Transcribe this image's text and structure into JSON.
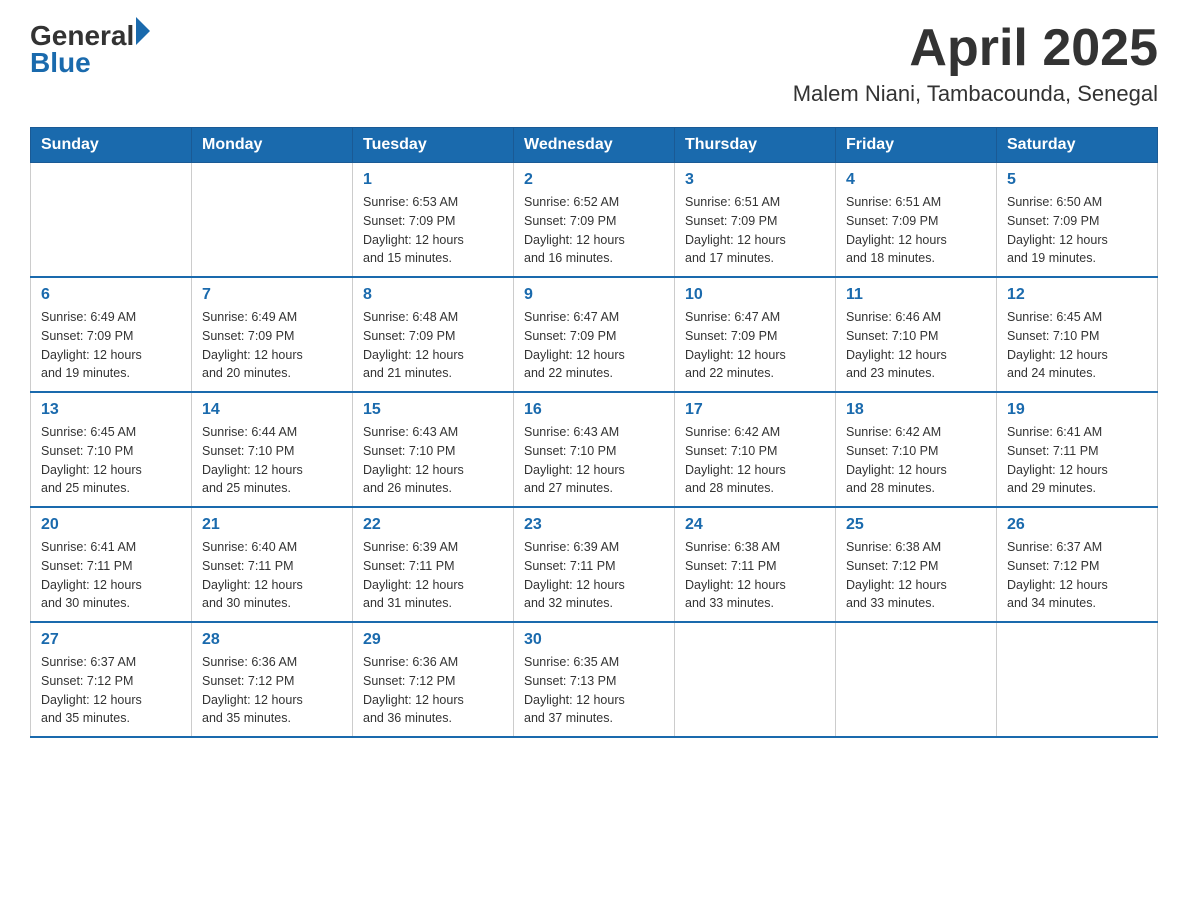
{
  "header": {
    "logo_general": "General",
    "logo_blue": "Blue",
    "title": "April 2025",
    "subtitle": "Malem Niani, Tambacounda, Senegal"
  },
  "calendar": {
    "days_of_week": [
      "Sunday",
      "Monday",
      "Tuesday",
      "Wednesday",
      "Thursday",
      "Friday",
      "Saturday"
    ],
    "weeks": [
      [
        {
          "day": "",
          "info": ""
        },
        {
          "day": "",
          "info": ""
        },
        {
          "day": "1",
          "info": "Sunrise: 6:53 AM\nSunset: 7:09 PM\nDaylight: 12 hours\nand 15 minutes."
        },
        {
          "day": "2",
          "info": "Sunrise: 6:52 AM\nSunset: 7:09 PM\nDaylight: 12 hours\nand 16 minutes."
        },
        {
          "day": "3",
          "info": "Sunrise: 6:51 AM\nSunset: 7:09 PM\nDaylight: 12 hours\nand 17 minutes."
        },
        {
          "day": "4",
          "info": "Sunrise: 6:51 AM\nSunset: 7:09 PM\nDaylight: 12 hours\nand 18 minutes."
        },
        {
          "day": "5",
          "info": "Sunrise: 6:50 AM\nSunset: 7:09 PM\nDaylight: 12 hours\nand 19 minutes."
        }
      ],
      [
        {
          "day": "6",
          "info": "Sunrise: 6:49 AM\nSunset: 7:09 PM\nDaylight: 12 hours\nand 19 minutes."
        },
        {
          "day": "7",
          "info": "Sunrise: 6:49 AM\nSunset: 7:09 PM\nDaylight: 12 hours\nand 20 minutes."
        },
        {
          "day": "8",
          "info": "Sunrise: 6:48 AM\nSunset: 7:09 PM\nDaylight: 12 hours\nand 21 minutes."
        },
        {
          "day": "9",
          "info": "Sunrise: 6:47 AM\nSunset: 7:09 PM\nDaylight: 12 hours\nand 22 minutes."
        },
        {
          "day": "10",
          "info": "Sunrise: 6:47 AM\nSunset: 7:09 PM\nDaylight: 12 hours\nand 22 minutes."
        },
        {
          "day": "11",
          "info": "Sunrise: 6:46 AM\nSunset: 7:10 PM\nDaylight: 12 hours\nand 23 minutes."
        },
        {
          "day": "12",
          "info": "Sunrise: 6:45 AM\nSunset: 7:10 PM\nDaylight: 12 hours\nand 24 minutes."
        }
      ],
      [
        {
          "day": "13",
          "info": "Sunrise: 6:45 AM\nSunset: 7:10 PM\nDaylight: 12 hours\nand 25 minutes."
        },
        {
          "day": "14",
          "info": "Sunrise: 6:44 AM\nSunset: 7:10 PM\nDaylight: 12 hours\nand 25 minutes."
        },
        {
          "day": "15",
          "info": "Sunrise: 6:43 AM\nSunset: 7:10 PM\nDaylight: 12 hours\nand 26 minutes."
        },
        {
          "day": "16",
          "info": "Sunrise: 6:43 AM\nSunset: 7:10 PM\nDaylight: 12 hours\nand 27 minutes."
        },
        {
          "day": "17",
          "info": "Sunrise: 6:42 AM\nSunset: 7:10 PM\nDaylight: 12 hours\nand 28 minutes."
        },
        {
          "day": "18",
          "info": "Sunrise: 6:42 AM\nSunset: 7:10 PM\nDaylight: 12 hours\nand 28 minutes."
        },
        {
          "day": "19",
          "info": "Sunrise: 6:41 AM\nSunset: 7:11 PM\nDaylight: 12 hours\nand 29 minutes."
        }
      ],
      [
        {
          "day": "20",
          "info": "Sunrise: 6:41 AM\nSunset: 7:11 PM\nDaylight: 12 hours\nand 30 minutes."
        },
        {
          "day": "21",
          "info": "Sunrise: 6:40 AM\nSunset: 7:11 PM\nDaylight: 12 hours\nand 30 minutes."
        },
        {
          "day": "22",
          "info": "Sunrise: 6:39 AM\nSunset: 7:11 PM\nDaylight: 12 hours\nand 31 minutes."
        },
        {
          "day": "23",
          "info": "Sunrise: 6:39 AM\nSunset: 7:11 PM\nDaylight: 12 hours\nand 32 minutes."
        },
        {
          "day": "24",
          "info": "Sunrise: 6:38 AM\nSunset: 7:11 PM\nDaylight: 12 hours\nand 33 minutes."
        },
        {
          "day": "25",
          "info": "Sunrise: 6:38 AM\nSunset: 7:12 PM\nDaylight: 12 hours\nand 33 minutes."
        },
        {
          "day": "26",
          "info": "Sunrise: 6:37 AM\nSunset: 7:12 PM\nDaylight: 12 hours\nand 34 minutes."
        }
      ],
      [
        {
          "day": "27",
          "info": "Sunrise: 6:37 AM\nSunset: 7:12 PM\nDaylight: 12 hours\nand 35 minutes."
        },
        {
          "day": "28",
          "info": "Sunrise: 6:36 AM\nSunset: 7:12 PM\nDaylight: 12 hours\nand 35 minutes."
        },
        {
          "day": "29",
          "info": "Sunrise: 6:36 AM\nSunset: 7:12 PM\nDaylight: 12 hours\nand 36 minutes."
        },
        {
          "day": "30",
          "info": "Sunrise: 6:35 AM\nSunset: 7:13 PM\nDaylight: 12 hours\nand 37 minutes."
        },
        {
          "day": "",
          "info": ""
        },
        {
          "day": "",
          "info": ""
        },
        {
          "day": "",
          "info": ""
        }
      ]
    ]
  }
}
